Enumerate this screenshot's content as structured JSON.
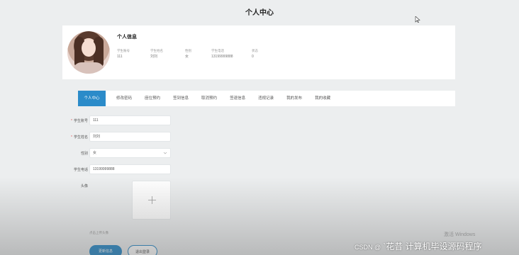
{
  "page": {
    "title": "个人中心"
  },
  "profile": {
    "heading": "个人信息",
    "fields": [
      {
        "label": "学生账号",
        "value": "111"
      },
      {
        "label": "学生姓名",
        "value": "刘刘"
      },
      {
        "label": "性别",
        "value": "女"
      },
      {
        "label": "学生电话",
        "value": "13199999888"
      },
      {
        "label": "状态",
        "value": "0"
      }
    ]
  },
  "tabs": [
    {
      "label": "个人中心",
      "active": true
    },
    {
      "label": "修改密码"
    },
    {
      "label": "座位预约"
    },
    {
      "label": "签到信息"
    },
    {
      "label": "取消预约"
    },
    {
      "label": "签退信息"
    },
    {
      "label": "违规记录"
    },
    {
      "label": "我的发布"
    },
    {
      "label": "我的收藏"
    }
  ],
  "form": {
    "account": {
      "label": "学生账号",
      "value": "111",
      "required": "*"
    },
    "name": {
      "label": "学生姓名",
      "value": "刘刘",
      "required": "*"
    },
    "gender": {
      "label": "性别",
      "value": "女"
    },
    "phone": {
      "label": "学生电话",
      "value": "13199999888"
    },
    "avatar": {
      "label": "头像"
    },
    "upload_hint": "点击上传头像",
    "update_label": "更新信息",
    "logout_label": "退出登录"
  },
  "watermarks": {
    "windows": "激活 Windows",
    "csdn_prefix": "CSDN @",
    "csdn_name": "`花昔  计算机毕设源码程序"
  },
  "colors": {
    "accent": "#2b8bc9",
    "required": "#e05b5b"
  },
  "icons": [
    "cursor-icon",
    "chevron-down-icon",
    "plus-icon"
  ]
}
